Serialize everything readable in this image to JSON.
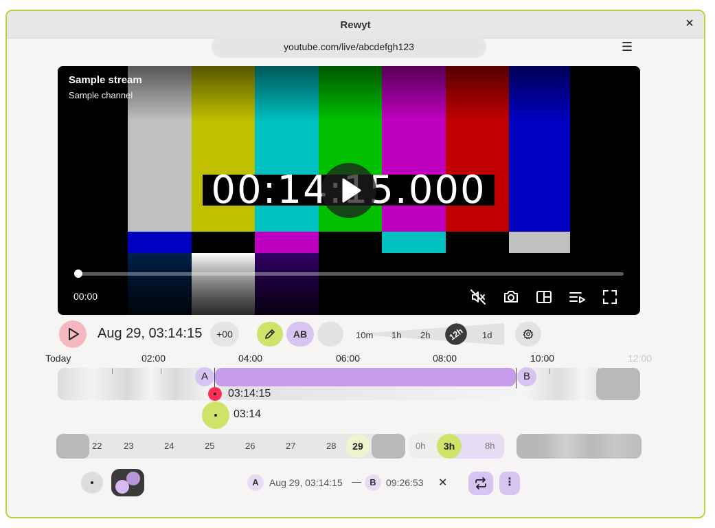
{
  "window": {
    "title": "Rewyt",
    "close_label": "✕"
  },
  "address": {
    "url": "youtube.com/live/abcdefgh123"
  },
  "video": {
    "stream_title": "Sample stream",
    "channel_name": "Sample channel",
    "overlay_timecode": "00:14:15.000",
    "current_time": "00:00",
    "progress_fraction": 0.0,
    "bar_colors_top": [
      "#000000",
      "#c0c0c0",
      "#c0c000",
      "#00c0c0",
      "#00c000",
      "#c000c0",
      "#c00000",
      "#0000c0",
      "#000000"
    ],
    "bar_colors_mid": [
      "#000000",
      "#0000c0",
      "#000000",
      "#c000c0",
      "#000000",
      "#00c0c0",
      "#000000",
      "#c0c0c0",
      "#000000"
    ],
    "bar_colors_bot": [
      "#000000",
      "#00214c",
      "#ffffff",
      "#32006a",
      "#000000",
      "#000000",
      "#000000",
      "#000000",
      "#000000"
    ],
    "controls": [
      "mute-icon",
      "camera-icon",
      "pip-icon",
      "playlist-icon",
      "fullscreen-icon"
    ]
  },
  "player": {
    "datetime": "Aug 29, 03:14:15",
    "timezone_label": "+00",
    "ab_label": "AB",
    "zoom_levels": [
      "10m",
      "1h",
      "2h",
      "12h",
      "1d"
    ],
    "zoom_active": "12h"
  },
  "timeline": {
    "labels": [
      "Today",
      "02:00",
      "04:00",
      "06:00",
      "08:00",
      "10:00",
      "12:00"
    ],
    "marker_a": "A",
    "marker_b": "B",
    "position_time": "03:14:15",
    "cursor_time": "03:14"
  },
  "days": {
    "labels": [
      "22",
      "23",
      "24",
      "25",
      "26",
      "27",
      "28"
    ],
    "active": "29"
  },
  "hours": {
    "labels": [
      "0h",
      "8h"
    ],
    "active": "3h"
  },
  "ab_loop": {
    "a_label": "A",
    "a_time": "Aug 29, 03:14:15",
    "dash": "—",
    "b_label": "B",
    "b_time": "09:26:53",
    "clear_label": "✕",
    "more_label": "⋮"
  },
  "colors": {
    "accent_green": "#cde36a",
    "accent_purple": "#c69cea",
    "record_red": "#ff2d55",
    "window_border": "#b5d63e"
  }
}
